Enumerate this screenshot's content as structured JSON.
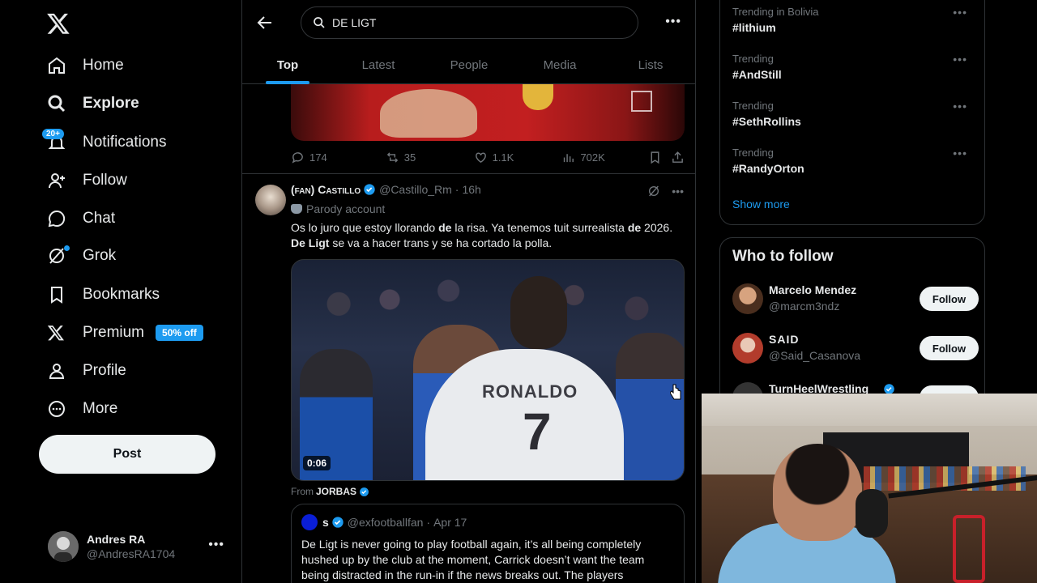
{
  "nav": {
    "items": [
      {
        "label": "Home",
        "icon": "home-icon"
      },
      {
        "label": "Explore",
        "icon": "search-icon",
        "active": true
      },
      {
        "label": "Notifications",
        "icon": "bell-icon",
        "badge": "20+"
      },
      {
        "label": "Follow",
        "icon": "add-user-icon"
      },
      {
        "label": "Chat",
        "icon": "chat-icon"
      },
      {
        "label": "Grok",
        "icon": "grok-icon"
      },
      {
        "label": "Bookmarks",
        "icon": "bookmark-icon"
      },
      {
        "label": "Premium",
        "icon": "x-logo-icon",
        "badge": "50% off"
      },
      {
        "label": "Profile",
        "icon": "person-icon"
      },
      {
        "label": "More",
        "icon": "more-circle-icon"
      }
    ],
    "post_label": "Post"
  },
  "account": {
    "name": "Andres RA",
    "handle": "@AndresRA1704"
  },
  "search": {
    "query": "DE LIGT"
  },
  "tabs": [
    "Top",
    "Latest",
    "People",
    "Media",
    "Lists"
  ],
  "prev_tweet": {
    "replies": "174",
    "retweets": "35",
    "likes": "1.1K",
    "views": "702K"
  },
  "tweet": {
    "name": "(fan) Castillo",
    "handle": "@Castillo_Rm",
    "time": "16h",
    "parody": "Parody account",
    "text_html": "Os lo juro que estoy llorando <b>de</b> la risa. Ya tenemos tuit surrealista <b>de</b> 2026. <b>De Ligt</b> se va a hacer trans y se ha cortado la polla.",
    "video_duration": "0:06",
    "jersey_name": "RONALDO",
    "jersey_number": "7",
    "from_prefix": "From",
    "from_name": "JORBAS"
  },
  "quote": {
    "name": "s",
    "handle": "@exfootballfan",
    "date": "Apr 17",
    "text": "De Ligt is never going to play football again, it’s all being completely hushed up by the club at the moment, Carrick doesn’t want the team being distracted in the run-in if the news breaks out. The players"
  },
  "trends": [
    {
      "category": "Trending in Bolivia",
      "name": "#lithium"
    },
    {
      "category": "Trending",
      "name": "#AndStill"
    },
    {
      "category": "Trending",
      "name": "#SethRollins"
    },
    {
      "category": "Trending",
      "name": "#RandyOrton"
    }
  ],
  "show_more": "Show more",
  "who_to_follow": {
    "title": "Who to follow",
    "users": [
      {
        "name": "Marcelo Mendez",
        "handle": "@marcm3ndz",
        "button": "Follow"
      },
      {
        "name": "SAID",
        "handle": "@Said_Casanova",
        "button": "Follow"
      },
      {
        "name": "TurnHeelWrestling",
        "handle": "",
        "button": "Follow"
      }
    ]
  },
  "colors": {
    "accent": "#1d9bf0",
    "background": "#000000",
    "text": "#e7e9ea",
    "muted": "#71767b"
  }
}
